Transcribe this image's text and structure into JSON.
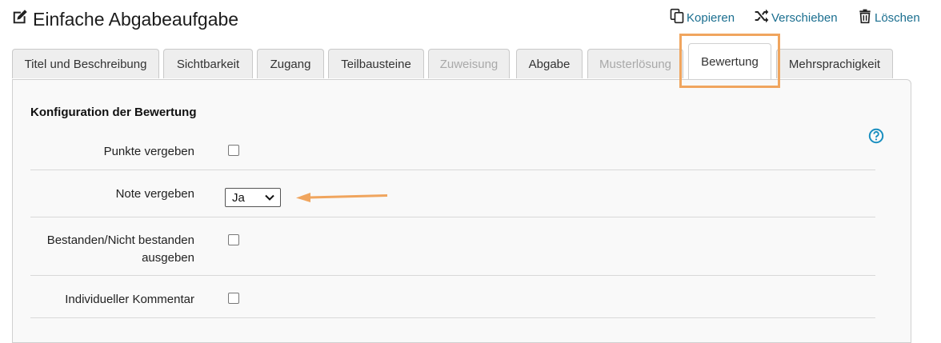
{
  "page": {
    "title": "Einfache Abgabeaufgabe",
    "title_icon": "edit-icon"
  },
  "toolbar": {
    "copy_label": "Kopieren",
    "copy_icon": "copy-icon",
    "move_label": "Verschieben",
    "move_icon": "shuffle-icon",
    "delete_label": "Löschen",
    "delete_icon": "trash-icon",
    "link_color": "#1a6e8f"
  },
  "tabs": [
    {
      "label": "Titel und Beschreibung",
      "state": "normal"
    },
    {
      "label": "Sichtbarkeit",
      "state": "normal"
    },
    {
      "label": "Zugang",
      "state": "normal"
    },
    {
      "label": "Teilbausteine",
      "state": "normal"
    },
    {
      "label": "Zuweisung",
      "state": "disabled"
    },
    {
      "label": "Abgabe",
      "state": "normal"
    },
    {
      "label": "Musterlösung",
      "state": "disabled"
    },
    {
      "label": "Bewertung",
      "state": "active"
    },
    {
      "label": "Mehrsprachigkeit",
      "state": "normal"
    }
  ],
  "section": {
    "title": "Konfiguration der Bewertung",
    "help_icon": "help-circle-icon"
  },
  "form": {
    "points": {
      "label": "Punkte vergeben",
      "checked": false
    },
    "grade": {
      "label": "Note vergeben",
      "selected": "Ja"
    },
    "passed": {
      "label_line1": "Bestanden/Nicht bestanden",
      "label_line2": "ausgeben",
      "checked": false
    },
    "comment": {
      "label": "Individueller Kommentar",
      "checked": false
    }
  },
  "annotation": {
    "highlight_color": "#f0a55e",
    "arrow_color": "#f0a55e"
  }
}
